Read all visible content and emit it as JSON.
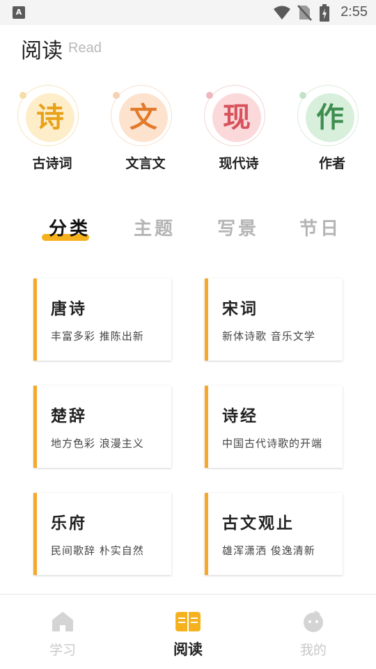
{
  "status_bar": {
    "time": "2:55",
    "app_badge": "A"
  },
  "header": {
    "title": "阅读",
    "subtitle": "Read"
  },
  "categories": [
    {
      "glyph": "诗",
      "label": "古诗词"
    },
    {
      "glyph": "文",
      "label": "文言文"
    },
    {
      "glyph": "现",
      "label": "现代诗"
    },
    {
      "glyph": "作",
      "label": "作者"
    }
  ],
  "tabs": [
    {
      "label": "分类",
      "active": true
    },
    {
      "label": "主题",
      "active": false
    },
    {
      "label": "写景",
      "active": false
    },
    {
      "label": "节日",
      "active": false
    }
  ],
  "cards": [
    {
      "title": "唐诗",
      "desc": "丰富多彩 推陈出新"
    },
    {
      "title": "宋词",
      "desc": "新体诗歌 音乐文学"
    },
    {
      "title": "楚辞",
      "desc": "地方色彩 浪漫主义"
    },
    {
      "title": "诗经",
      "desc": "中国古代诗歌的开端"
    },
    {
      "title": "乐府",
      "desc": "民间歌辞 朴实自然"
    },
    {
      "title": "古文观止",
      "desc": "雄浑潇洒 俊逸清新"
    }
  ],
  "bottom_nav": [
    {
      "label": "学习",
      "icon": "home-icon",
      "active": false
    },
    {
      "label": "阅读",
      "icon": "book-icon",
      "active": true
    },
    {
      "label": "我的",
      "icon": "profile-icon",
      "active": false
    }
  ],
  "colors": {
    "accent": "#f6b21e",
    "card_bar": "#f7a72a"
  }
}
